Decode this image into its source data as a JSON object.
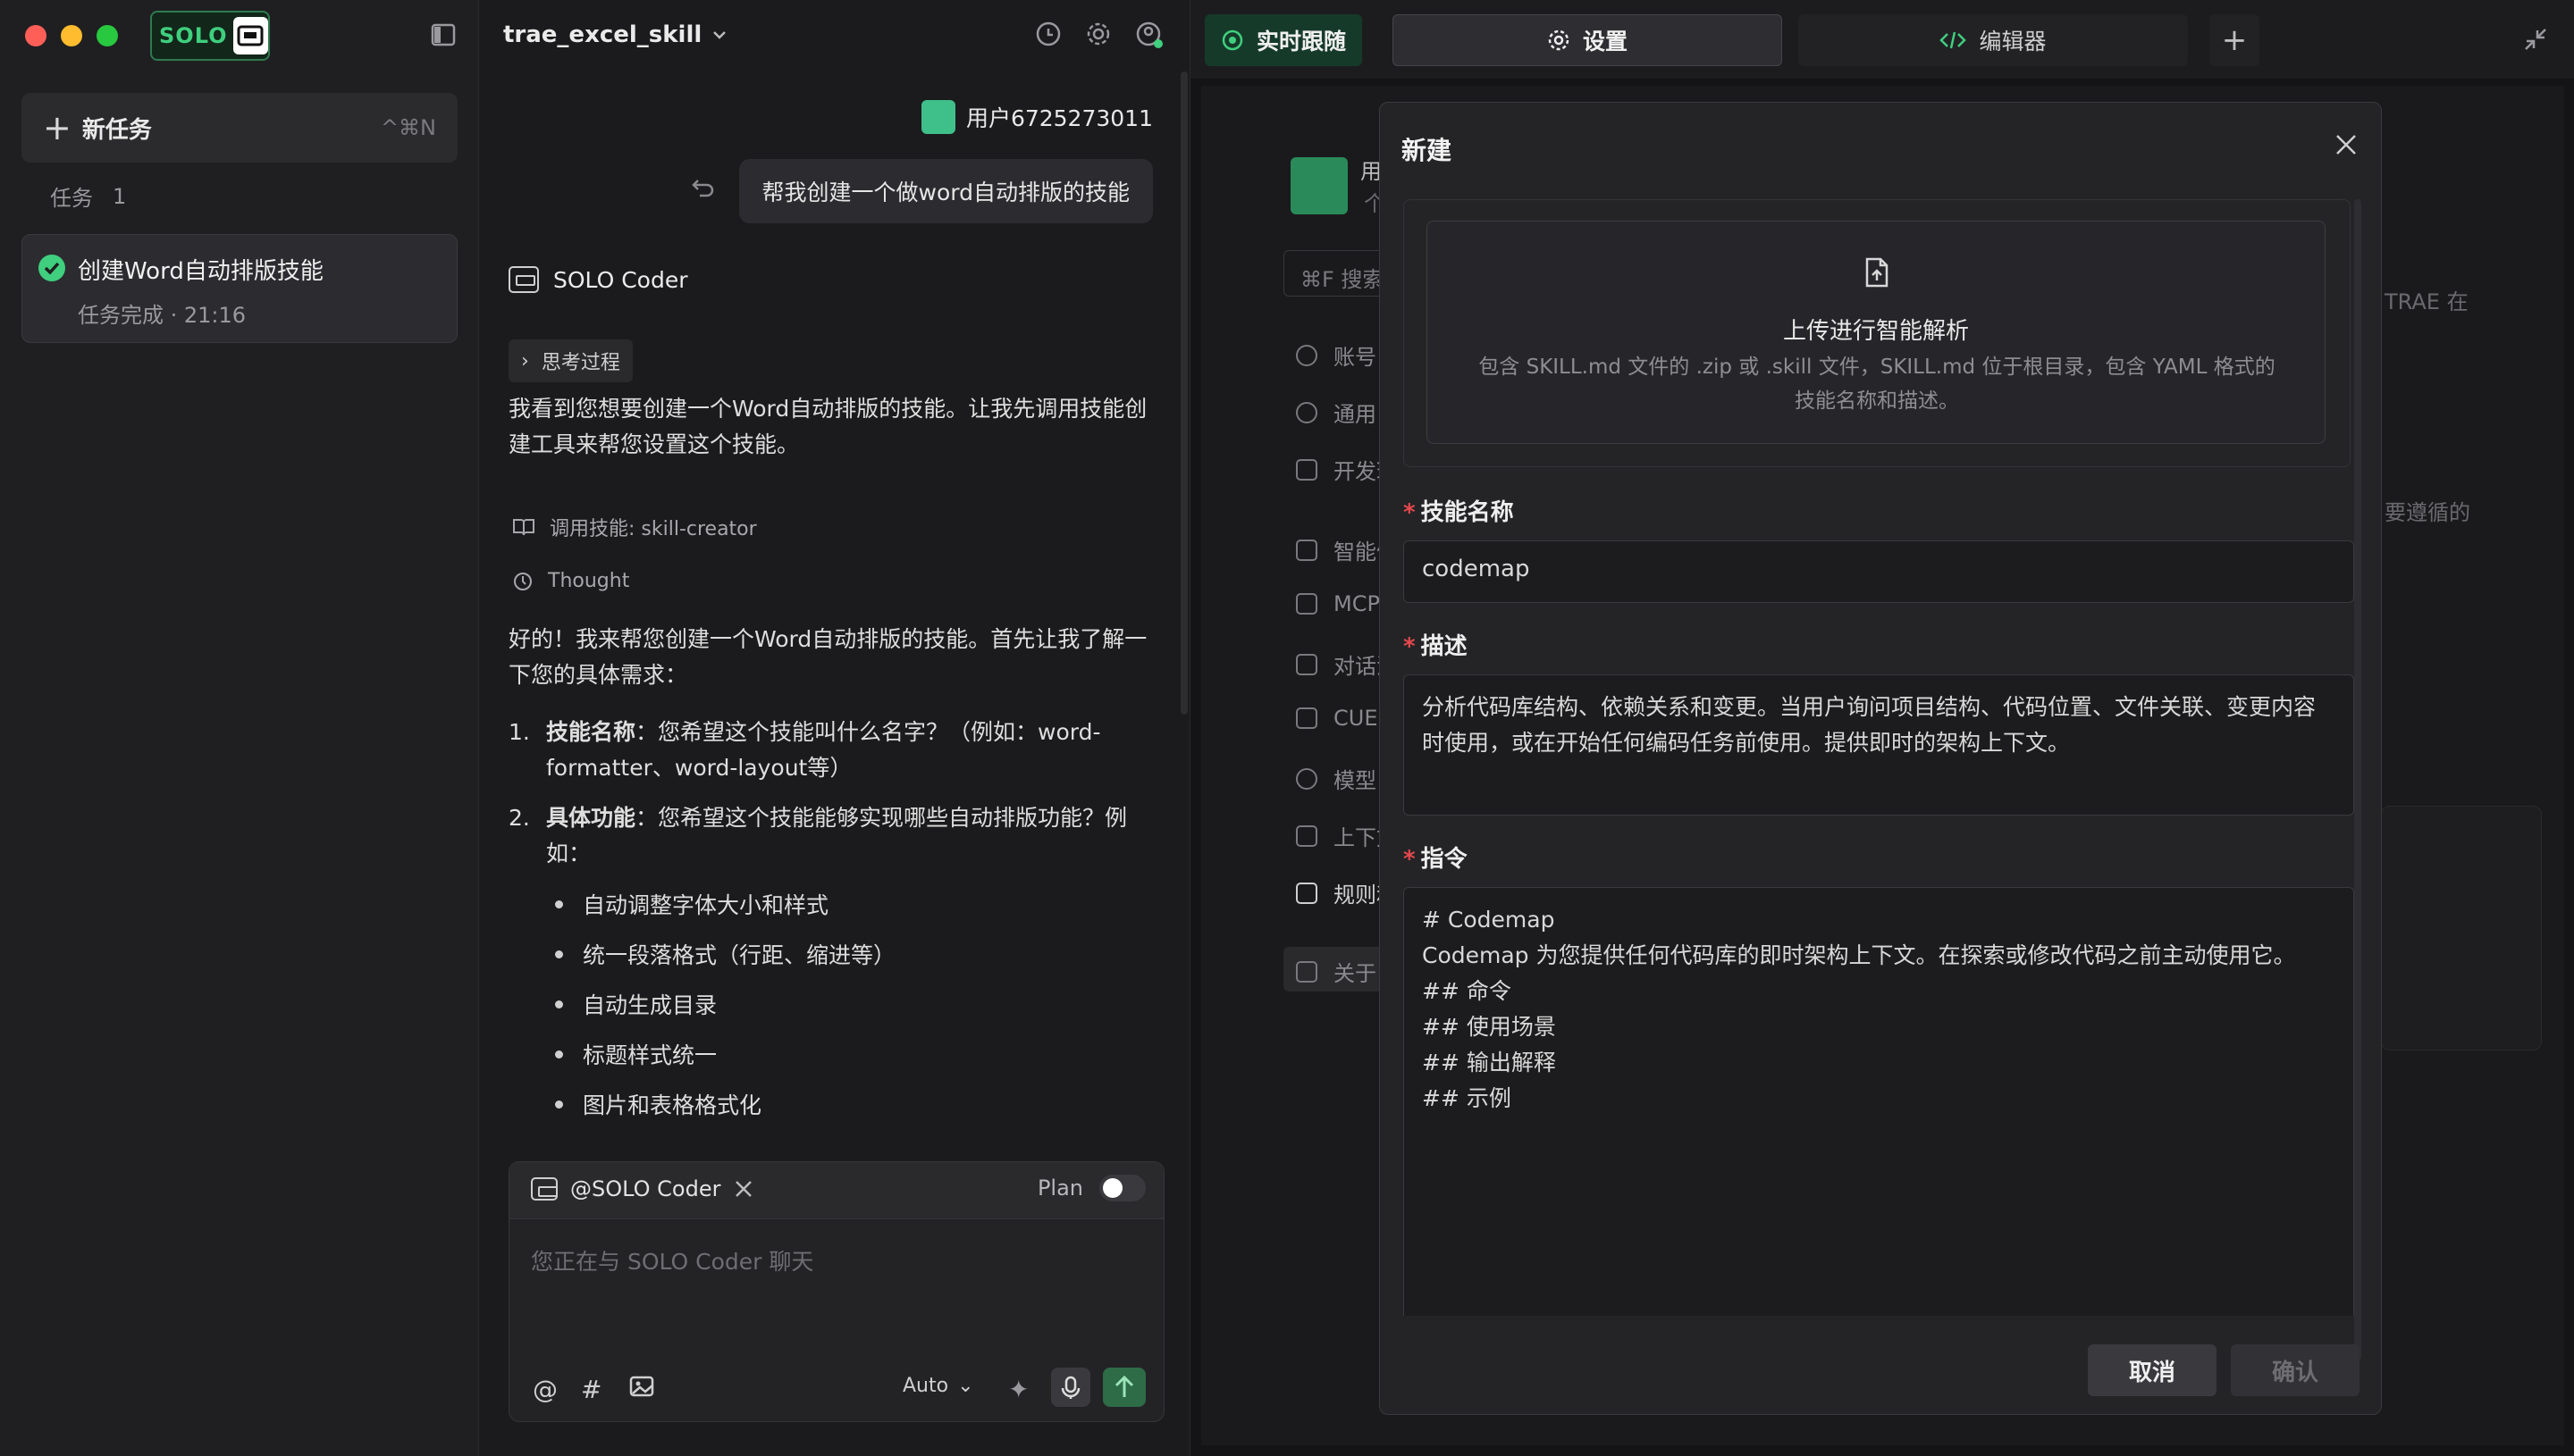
{
  "sidebar": {
    "logo_text": "SOLO",
    "new_task_label": "新任务",
    "new_task_shortcut": "^⌘N",
    "tasks_label": "任务",
    "tasks_count": "1",
    "task_title": "创建Word自动排版技能",
    "task_status": "任务完成 · 21:16"
  },
  "chat": {
    "project_name": "trae_excel_skill",
    "user_name": "用户6725273011",
    "user_message": "帮我创建一个做word自动排版的技能",
    "agent_name": "SOLO Coder",
    "thinking_label": "思考过程",
    "para1": "我看到您想要创建一个Word自动排版的技能。让我先调用技能创建工具来帮您设置这个技能。",
    "skill_call": "调用技能: skill-creator",
    "thought_label": "Thought",
    "para2": "好的！我来帮您创建一个Word自动排版的技能。首先让我了解一下您的具体需求：",
    "q1_num": "1.",
    "q1_bold": "技能名称",
    "q1_text": "：您希望这个技能叫什么名字？（例如：word-formatter、word-layout等）",
    "q2_num": "2.",
    "q2_bold": "具体功能",
    "q2_text": "：您希望这个技能能够实现哪些自动排版功能？例如：",
    "bullets": [
      "自动调整字体大小和样式",
      "统一段落格式（行距、缩进等）",
      "自动生成目录",
      "标题样式统一",
      "图片和表格格式化"
    ],
    "input_mention": "@SOLO Coder",
    "plan_label": "Plan",
    "input_placeholder": "您正在与 SOLO Coder 聊天",
    "model_label": "Auto"
  },
  "tabs": {
    "live": "实时跟随",
    "settings": "设置",
    "editor": "编辑器"
  },
  "settings_bg": {
    "user_partial": "用户",
    "user_sub": "个",
    "search": "⌘F 搜索",
    "items": [
      "账号",
      "通用",
      "开发环",
      "智能体",
      "MCP",
      "对话流",
      "CUE",
      "模型",
      "上下文",
      "规则和",
      "关于"
    ],
    "right_text1": "TRAE 在",
    "right_text2": "要遵循的"
  },
  "modal": {
    "title": "新建",
    "upload_title": "上传进行智能解析",
    "upload_desc": "包含 SKILL.md 文件的 .zip 或 .skill 文件，SKILL.md 位于根目录，包含 YAML 格式的技能名称和描述。",
    "name_label": "技能名称",
    "name_value": "codemap",
    "desc_label": "描述",
    "desc_value": "分析代码库结构、依赖关系和变更。当用户询问项目结构、代码位置、文件关联、变更内容时使用，或在开始任何编码任务前使用。提供即时的架构上下文。",
    "instr_label": "指令",
    "instr_value": "# Codemap\nCodemap 为您提供任何代码库的即时架构上下文。在探索或修改代码之前主动使用它。\n## 命令\n## 使用场景\n## 输出解释\n## 示例",
    "required_mark": "*",
    "cancel": "取消",
    "confirm": "确认"
  },
  "colors": {
    "accent_green": "#3fcf7e",
    "required_red": "#e5484d"
  }
}
